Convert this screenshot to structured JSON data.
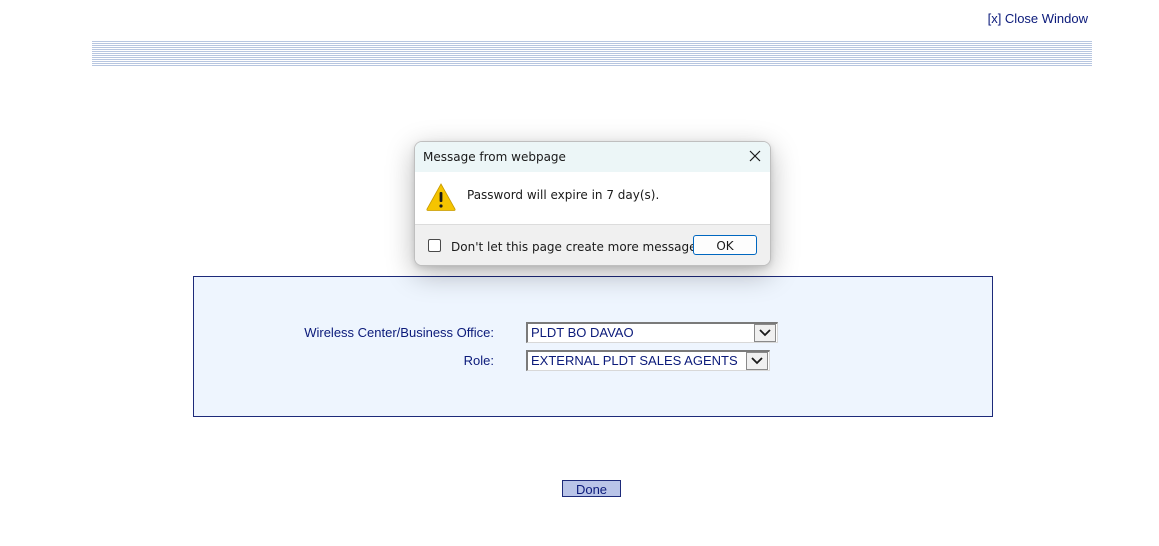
{
  "header": {
    "close_window_label": "[x] Close Window"
  },
  "form": {
    "office_label": "Wireless Center/Business Office:",
    "office_value": "PLDT BO DAVAO",
    "role_label": "Role:",
    "role_value": "EXTERNAL PLDT SALES AGENTS"
  },
  "actions": {
    "done_label": "Done"
  },
  "dialog": {
    "title": "Message from webpage",
    "message": "Password will expire in 7 day(s).",
    "checkbox_label": "Don't let this page create more messages",
    "checkbox_checked": false,
    "ok_label": "OK",
    "icon": "warning-icon"
  },
  "colors": {
    "link_text": "#0b1a7a",
    "panel_background": "#eef5fe",
    "panel_border": "#1d2a7a",
    "done_button_background": "#b9c4e8",
    "banner_stripe": "#b7c6e0",
    "dialog_titlebar": "#ecf6f7",
    "dialog_ok_border": "#0067c0",
    "warning_yellow": "#f5c400"
  }
}
